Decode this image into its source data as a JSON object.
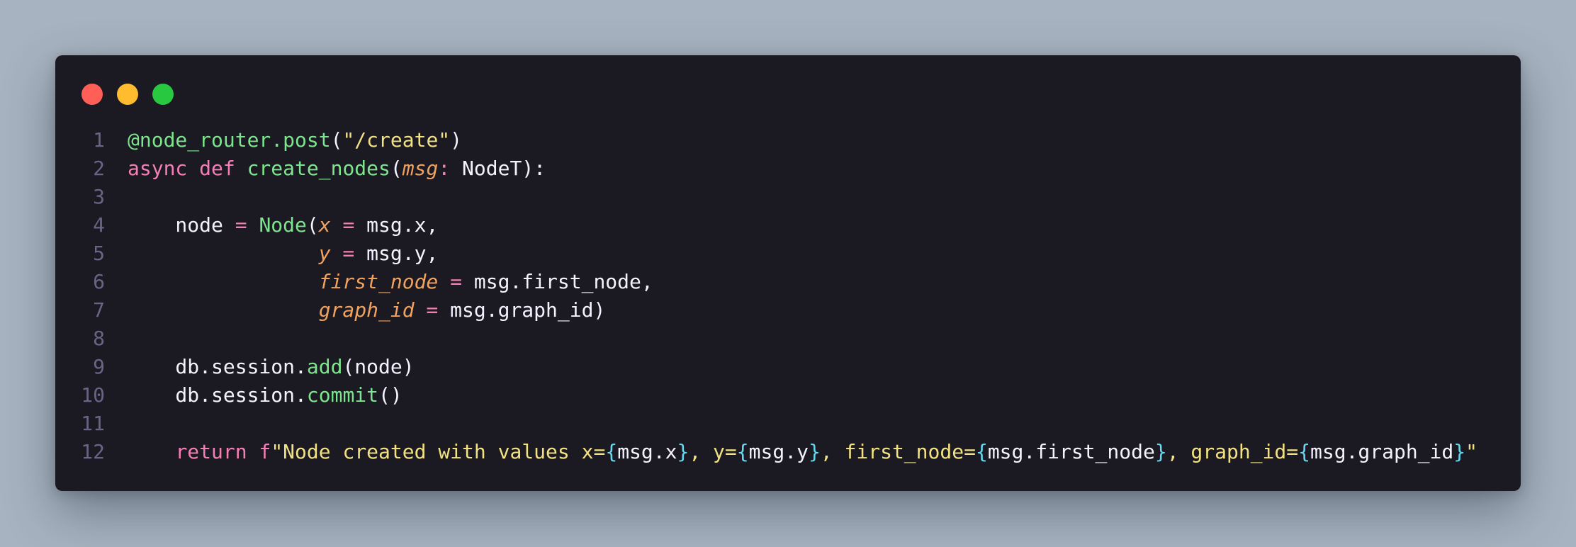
{
  "window": {
    "controls": [
      {
        "name": "close-dot",
        "color": "#ff5f57"
      },
      {
        "name": "minimize-dot",
        "color": "#febc2e"
      },
      {
        "name": "maximize-dot",
        "color": "#28c840"
      }
    ]
  },
  "code": {
    "lines": [
      {
        "number": "1",
        "tokens": [
          {
            "text": "@node_router.post",
            "type": "decorator"
          },
          {
            "text": "(",
            "type": "default"
          },
          {
            "text": "\"/create\"",
            "type": "string"
          },
          {
            "text": ")",
            "type": "default"
          }
        ]
      },
      {
        "number": "2",
        "tokens": [
          {
            "text": "async def ",
            "type": "keyword"
          },
          {
            "text": "create_nodes",
            "type": "function"
          },
          {
            "text": "(",
            "type": "default"
          },
          {
            "text": "msg",
            "type": "param"
          },
          {
            "text": ": ",
            "type": "operator"
          },
          {
            "text": "NodeT):",
            "type": "default"
          }
        ]
      },
      {
        "number": "3",
        "tokens": []
      },
      {
        "number": "4",
        "tokens": [
          {
            "text": "    node ",
            "type": "default"
          },
          {
            "text": "= ",
            "type": "operator"
          },
          {
            "text": "Node",
            "type": "class"
          },
          {
            "text": "(",
            "type": "default"
          },
          {
            "text": "x",
            "type": "param"
          },
          {
            "text": " = ",
            "type": "operator"
          },
          {
            "text": "msg.x,",
            "type": "default"
          }
        ]
      },
      {
        "number": "5",
        "tokens": [
          {
            "text": "                ",
            "type": "default"
          },
          {
            "text": "y",
            "type": "param"
          },
          {
            "text": " = ",
            "type": "operator"
          },
          {
            "text": "msg.y,",
            "type": "default"
          }
        ]
      },
      {
        "number": "6",
        "tokens": [
          {
            "text": "                ",
            "type": "default"
          },
          {
            "text": "first_node",
            "type": "param"
          },
          {
            "text": " = ",
            "type": "operator"
          },
          {
            "text": "msg.first_node,",
            "type": "default"
          }
        ]
      },
      {
        "number": "7",
        "tokens": [
          {
            "text": "                ",
            "type": "default"
          },
          {
            "text": "graph_id",
            "type": "param"
          },
          {
            "text": " = ",
            "type": "operator"
          },
          {
            "text": "msg.graph_id)",
            "type": "default"
          }
        ]
      },
      {
        "number": "8",
        "tokens": []
      },
      {
        "number": "9",
        "tokens": [
          {
            "text": "    db.session.",
            "type": "default"
          },
          {
            "text": "add",
            "type": "function"
          },
          {
            "text": "(node)",
            "type": "default"
          }
        ]
      },
      {
        "number": "10",
        "tokens": [
          {
            "text": "    db.session.",
            "type": "default"
          },
          {
            "text": "commit",
            "type": "function"
          },
          {
            "text": "()",
            "type": "default"
          }
        ]
      },
      {
        "number": "11",
        "tokens": []
      },
      {
        "number": "12",
        "tokens": [
          {
            "text": "    ",
            "type": "default"
          },
          {
            "text": "return ",
            "type": "keyword"
          },
          {
            "text": "f",
            "type": "keyword"
          },
          {
            "text": "\"Node created with values x=",
            "type": "string"
          },
          {
            "text": "{",
            "type": "brace"
          },
          {
            "text": "msg.x",
            "type": "default"
          },
          {
            "text": "}",
            "type": "brace"
          },
          {
            "text": ", y=",
            "type": "string"
          },
          {
            "text": "{",
            "type": "brace"
          },
          {
            "text": "msg.y",
            "type": "default"
          },
          {
            "text": "}",
            "type": "brace"
          },
          {
            "text": ", first_node=",
            "type": "string"
          },
          {
            "text": "{",
            "type": "brace"
          },
          {
            "text": "msg.first_node",
            "type": "default"
          },
          {
            "text": "}",
            "type": "brace"
          },
          {
            "text": ", graph_id=",
            "type": "string"
          },
          {
            "text": "{",
            "type": "brace"
          },
          {
            "text": "msg.graph_id",
            "type": "default"
          },
          {
            "text": "}",
            "type": "brace"
          },
          {
            "text": "\"",
            "type": "string"
          }
        ]
      }
    ]
  }
}
